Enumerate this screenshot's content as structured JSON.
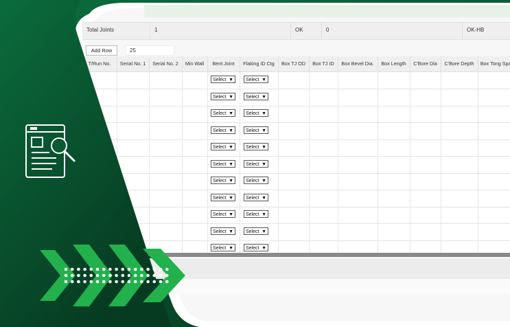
{
  "summary": {
    "label": "Total Joints",
    "total_value": "1",
    "ok_label": "OK",
    "ok_value": "0",
    "okhb_label": "OK-HB"
  },
  "toolbar": {
    "add_row_label": "Add Row",
    "row_count": "25"
  },
  "table": {
    "columns": [
      "T/Run No.",
      "Serial No. 1",
      "Serial No. 2",
      "Min Wall",
      "Bent Joint",
      "Flaking ID Ctg",
      "Box TJ OD",
      "Box TJ ID",
      "Box Bevel Dia.",
      "Box Length",
      "C'Bore Dia",
      "C'Bore Depth",
      "Box Tong Space"
    ],
    "select_label": "Select",
    "row_count": 11
  },
  "colors": {
    "brand_green": "#0b6b3c",
    "accent_green": "#22b14c",
    "header_tint": "#e6f2e6"
  },
  "icons": {
    "document_search": "document-search-icon",
    "arrows": "chevron-right-icon"
  }
}
